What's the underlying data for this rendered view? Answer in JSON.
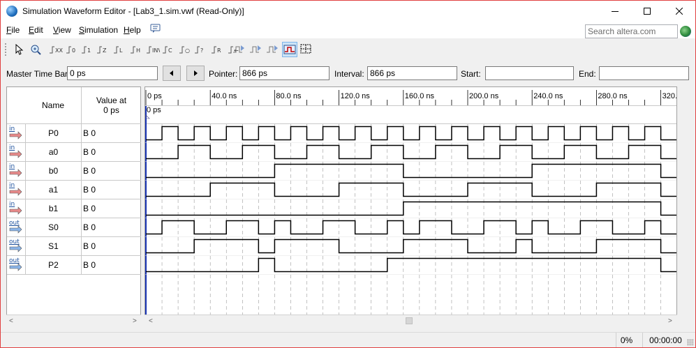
{
  "window": {
    "title": "Simulation Waveform Editor - [Lab3_1.sim.vwf (Read-Only)]"
  },
  "menu": [
    {
      "prefix": "",
      "ul": "F",
      "rest": "ile"
    },
    {
      "prefix": "",
      "ul": "E",
      "rest": "dit"
    },
    {
      "prefix": "",
      "ul": "V",
      "rest": "iew"
    },
    {
      "prefix": "",
      "ul": "S",
      "rest": "imulation"
    },
    {
      "prefix": "",
      "ul": "H",
      "rest": "elp"
    }
  ],
  "search": {
    "placeholder": "Search altera.com"
  },
  "toolbar": {
    "icons": [
      "selection-tool-icon",
      "zoom-tool-icon",
      "uninitialized-icon",
      "force-low-icon",
      "force-high-icon",
      "high-impedance-icon",
      "weak-low-icon",
      "weak-high-icon",
      "invert-icon",
      "count-value-icon",
      "overwrite-clock-icon",
      "random-values-icon",
      "dont-care-icon",
      "forcing-value-icon",
      "run-functional-simulation-icon",
      "run-timing-simulation-icon",
      "generate-netlist-icon",
      "snap-to-grid-icon",
      "grid-settings-icon"
    ]
  },
  "timebar": {
    "master_label": "Master Time Bar:",
    "master_value": "0 ps",
    "pointer_label": "Pointer:",
    "pointer_value": "866 ps",
    "interval_label": "Interval:",
    "interval_value": "866 ps",
    "start_label": "Start:",
    "start_value": "",
    "end_label": "End:",
    "end_value": ""
  },
  "table": {
    "name_header": "Name",
    "value_header_line1": "Value at",
    "value_header_line2": "0 ps"
  },
  "signals": [
    {
      "dir": "in",
      "name": "P0",
      "value": "B 0",
      "wave": [
        0,
        1,
        0,
        1,
        0,
        1,
        0,
        1,
        0,
        1,
        0,
        1,
        0,
        1,
        0,
        1,
        0,
        1,
        0,
        1,
        0,
        1,
        0,
        1,
        0,
        1,
        0,
        1,
        0,
        1,
        0,
        1,
        0
      ]
    },
    {
      "dir": "in",
      "name": "a0",
      "value": "B 0",
      "wave": [
        0,
        0,
        1,
        1,
        0,
        0,
        1,
        1,
        0,
        0,
        1,
        1,
        0,
        0,
        1,
        1,
        0,
        0,
        1,
        1,
        0,
        0,
        1,
        1,
        0,
        0,
        1,
        1,
        0,
        0,
        1,
        1,
        0
      ]
    },
    {
      "dir": "in",
      "name": "b0",
      "value": "B 0",
      "wave": [
        0,
        0,
        0,
        0,
        0,
        0,
        0,
        0,
        1,
        1,
        1,
        1,
        1,
        1,
        1,
        1,
        0,
        0,
        0,
        0,
        0,
        0,
        0,
        0,
        1,
        1,
        1,
        1,
        1,
        1,
        1,
        1,
        0
      ]
    },
    {
      "dir": "in",
      "name": "a1",
      "value": "B 0",
      "wave": [
        0,
        0,
        0,
        0,
        1,
        1,
        1,
        1,
        0,
        0,
        0,
        0,
        1,
        1,
        1,
        1,
        0,
        0,
        0,
        0,
        1,
        1,
        1,
        1,
        0,
        0,
        0,
        0,
        1,
        1,
        1,
        1,
        0
      ]
    },
    {
      "dir": "in",
      "name": "b1",
      "value": "B 0",
      "wave": [
        0,
        0,
        0,
        0,
        0,
        0,
        0,
        0,
        0,
        0,
        0,
        0,
        0,
        0,
        0,
        0,
        1,
        1,
        1,
        1,
        1,
        1,
        1,
        1,
        1,
        1,
        1,
        1,
        1,
        1,
        1,
        1,
        0
      ]
    },
    {
      "dir": "out",
      "name": "S0",
      "value": "B 0",
      "wave": [
        0,
        1,
        1,
        0,
        0,
        1,
        1,
        0,
        1,
        0,
        0,
        1,
        1,
        0,
        0,
        1,
        0,
        1,
        1,
        0,
        0,
        1,
        1,
        0,
        1,
        0,
        0,
        1,
        1,
        0,
        0,
        1,
        0
      ]
    },
    {
      "dir": "out",
      "name": "S1",
      "value": "B 0",
      "wave": [
        0,
        0,
        0,
        1,
        1,
        1,
        1,
        0,
        1,
        1,
        1,
        1,
        0,
        0,
        0,
        0,
        1,
        1,
        1,
        1,
        0,
        0,
        0,
        1,
        0,
        0,
        0,
        0,
        1,
        1,
        1,
        1,
        0
      ]
    },
    {
      "dir": "out",
      "name": "P2",
      "value": "B 0",
      "wave": [
        0,
        0,
        0,
        0,
        0,
        0,
        0,
        1,
        0,
        0,
        0,
        0,
        0,
        0,
        0,
        1,
        1,
        1,
        1,
        1,
        1,
        1,
        1,
        1,
        1,
        1,
        1,
        1,
        1,
        1,
        1,
        1,
        0
      ]
    }
  ],
  "timeline": {
    "ticks": [
      "0 ps",
      "40.0 ns",
      "80.0 ns",
      "120.0 ns",
      "160.0 ns",
      "200.0 ns",
      "240.0 ns",
      "280.0 ns",
      "320.0 ns"
    ],
    "marker_label": "0 ps",
    "ns_per_step": 10,
    "visible_ns": 330
  },
  "status": {
    "progress": "0%",
    "elapsed": "00:00:00"
  },
  "colors": {
    "wave": "#000000",
    "master_bar": "#1a35b5",
    "grid": "#9a9a9a",
    "window_border": "#e04040"
  }
}
